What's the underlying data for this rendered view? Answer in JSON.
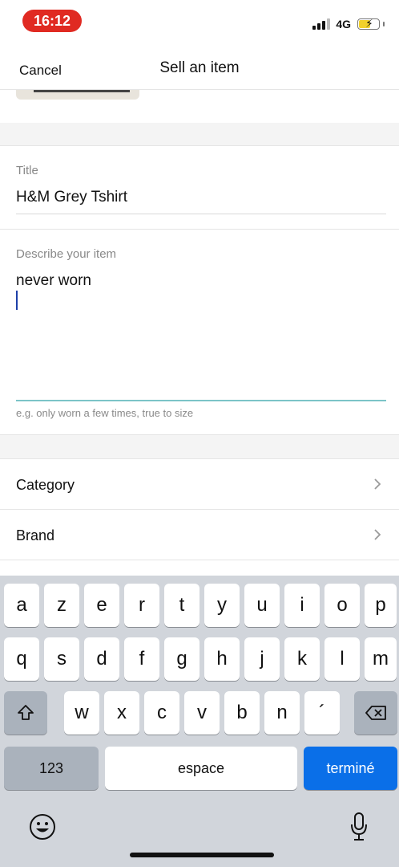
{
  "status": {
    "time": "16:12",
    "network": "4G"
  },
  "nav": {
    "cancel_label": "Cancel",
    "title": "Sell an item"
  },
  "form": {
    "title_label": "Title",
    "title_value": "H&M Grey Tshirt",
    "describe_label": "Describe your item",
    "describe_value": "never worn",
    "describe_hint": "e.g. only worn a few times, true to size"
  },
  "rows": {
    "category": "Category",
    "brand": "Brand"
  },
  "keyboard": {
    "row1": [
      "a",
      "z",
      "e",
      "r",
      "t",
      "y",
      "u",
      "i",
      "o",
      "p"
    ],
    "row2": [
      "q",
      "s",
      "d",
      "f",
      "g",
      "h",
      "j",
      "k",
      "l",
      "m"
    ],
    "row3": [
      "w",
      "x",
      "c",
      "v",
      "b",
      "n",
      "´"
    ],
    "numbers_label": "123",
    "space_label": "espace",
    "done_label": "terminé"
  },
  "colors": {
    "time_pill": "#e02a22",
    "done_key": "#0a6fe8",
    "caret": "#1d3fa8"
  }
}
